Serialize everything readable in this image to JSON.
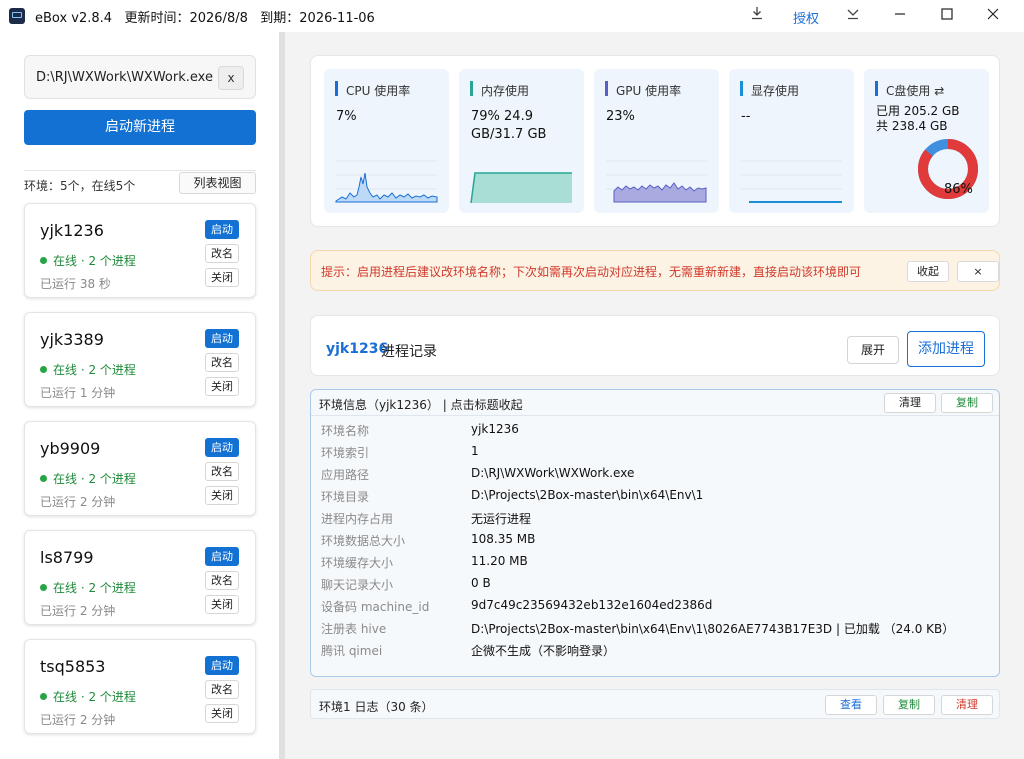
{
  "titlebar": {
    "app_name": "eBox v2.8.4",
    "update_label": "更新时间：2026/8/8",
    "expire_label": "到期：2026-11-06",
    "license_label": "授权",
    "download_icon": "download-icon",
    "dropdown_icon": "chevron-down-icon"
  },
  "sidebar": {
    "exe_path": "D:\\RJ\\WXWork\\WXWork.exe",
    "clear_label": "x",
    "start_label": "启动新进程",
    "env_summary": "环境：5个，在线5个",
    "list_view_label": "列表视图",
    "environments": [
      {
        "name": "yjk1236",
        "status": "在线 · 2 个进程",
        "uptime": "已运行 38 秒"
      },
      {
        "name": "yjk3389",
        "status": "在线 · 2 个进程",
        "uptime": "已运行 1 分钟"
      },
      {
        "name": "yb9909",
        "status": "在线 · 2 个进程",
        "uptime": "已运行 2 分钟"
      },
      {
        "name": "ls8799",
        "status": "在线 · 2 个进程",
        "uptime": "已运行 2 分钟"
      },
      {
        "name": "tsq5853",
        "status": "在线 · 2 个进程",
        "uptime": "已运行 2 分钟"
      }
    ],
    "card_buttons": {
      "start": "启动",
      "rename": "改名",
      "close": "关闭"
    }
  },
  "stats": [
    {
      "label": "CPU 使用率",
      "value": "7%",
      "accent": "#1a6fd6"
    },
    {
      "label": "内存使用",
      "value": "79%  24.9 GB/31.7 GB",
      "accent": "#29a597"
    },
    {
      "label": "GPU 使用率",
      "value": "23%",
      "accent": "#5a5fc8"
    },
    {
      "label": "显存使用",
      "value": "--",
      "accent": "#1a8fd6"
    },
    {
      "label": "C盘使用 ⇄",
      "used": "已用 205.2 GB",
      "total": "共 238.4 GB",
      "percent_label": "86%",
      "percent": 86,
      "accent": "#1a6fd6"
    }
  ],
  "tip": {
    "text": "提示：启用进程后建议改环境名称；下次如需再次启动对应进程，无需重新新建，直接启动该环境即可",
    "collapse_label": "收起",
    "close_label": "×"
  },
  "records": {
    "env_name": "yjk1236",
    "title": "进程记录",
    "expand_label": "展开",
    "add_label": "添加进程"
  },
  "env_info": {
    "title": "环境信息（yjk1236） | 点击标题收起",
    "clear_label": "清理",
    "copy_label": "复制",
    "rows": [
      {
        "key": "环境名称",
        "value": "yjk1236"
      },
      {
        "key": "环境索引",
        "value": "1"
      },
      {
        "key": "应用路径",
        "value": "D:\\RJ\\WXWork\\WXWork.exe"
      },
      {
        "key": "环境目录",
        "value": "D:\\Projects\\2Box-master\\bin\\x64\\Env\\1"
      },
      {
        "key": "进程内存占用",
        "value": "无运行进程"
      },
      {
        "key": "环境数据总大小",
        "value": "108.35 MB"
      },
      {
        "key": "环境缓存大小",
        "value": "11.20 MB"
      },
      {
        "key": "聊天记录大小",
        "value": "0 B"
      },
      {
        "key": "设备码 machine_id",
        "value": "9d7c49c23569432eb132e1604ed2386d"
      },
      {
        "key": "注册表 hive",
        "value": "D:\\Projects\\2Box-master\\bin\\x64\\Env\\1\\8026AE7743B17E3D | 已加载 （24.0 KB）"
      },
      {
        "key": "腾讯 qimei",
        "value": "企微不生成（不影响登录）"
      }
    ]
  },
  "log": {
    "title": "环境1 日志（30 条）",
    "view_label": "查看",
    "copy_label": "复制",
    "clear_label": "清理"
  },
  "colors": {
    "primary": "#1271d3",
    "online": "#27a443",
    "danger": "#d0392b",
    "copy_green": "#1e8a3a",
    "disk_used": "#e03a3a",
    "disk_free": "#3f8ee0"
  }
}
